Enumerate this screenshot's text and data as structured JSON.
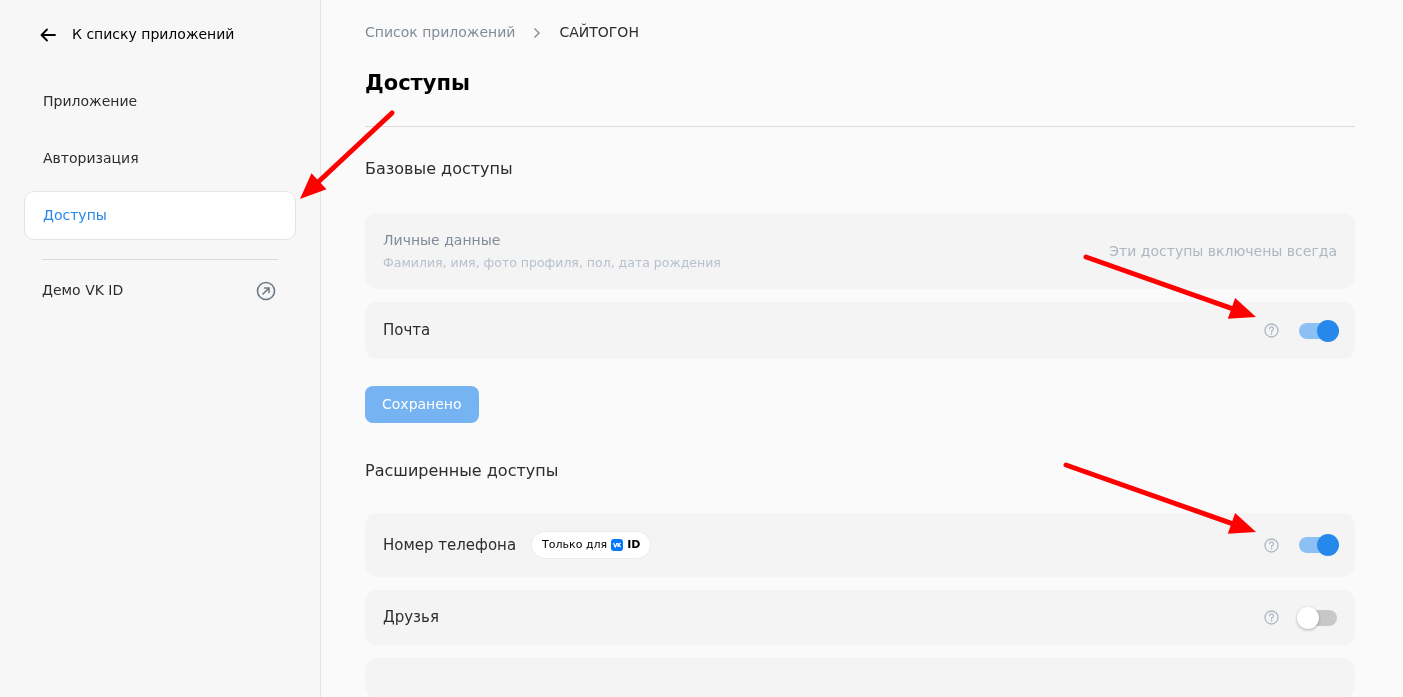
{
  "sidebar": {
    "back_link": "К списку приложений",
    "items": [
      {
        "label": "Приложение",
        "selected": false,
        "pointed_at": false
      },
      {
        "label": "Авторизация",
        "selected": false,
        "pointed_at": false
      },
      {
        "label": "Доступы",
        "selected": true,
        "pointed_at": true
      }
    ],
    "external_link": "Демо VK ID"
  },
  "breadcrumb": [
    "Список приложений",
    "САЙТОГОН"
  ],
  "title": "Доступы",
  "basic": {
    "heading": "Базовые доступы",
    "rows": [
      {
        "kind": "fixed",
        "label": "Личные данные",
        "description": "Фамилия, имя, фото профиля, пол, дата рождения",
        "note": "Эти доступы включены всегда"
      },
      {
        "kind": "toggle",
        "label": "Почта",
        "on": true,
        "pointed_at": true
      }
    ],
    "save_button": {
      "label": "Сохранено",
      "disabled": true
    }
  },
  "extended": {
    "heading": "Расширенные доступы",
    "rows": [
      {
        "kind": "toggle",
        "label": "Номер телефона",
        "badge": {
          "text": "Только для",
          "suffix": "ID"
        },
        "on": true,
        "pointed_at": true
      },
      {
        "kind": "toggle",
        "label": "Друзья",
        "on": false,
        "pointed_at": false
      },
      {
        "kind": "cut"
      }
    ]
  }
}
